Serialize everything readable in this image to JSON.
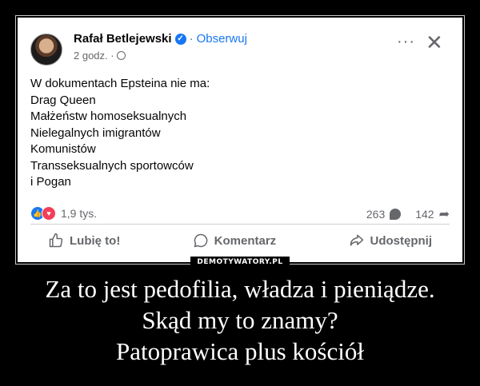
{
  "post": {
    "author": "Rafał Betlejewski",
    "separator": "·",
    "follow_label": "Obserwuj",
    "time": "2 godz. ·",
    "text_lines": [
      "W dokumentach Epsteina nie ma:",
      "Drag Queen",
      "Małżeństw homoseksualnych",
      "Nielegalnych imigrantów",
      "Komunistów",
      "Transseksualnych sportowców",
      "i Pogan"
    ],
    "reactions_count": "1,9 tys.",
    "comments_count": "263",
    "shares_count": "142",
    "more_label": "···",
    "close_label": "✕"
  },
  "actions": {
    "like": "Lubię to!",
    "comment": "Komentarz",
    "share": "Udostępnij"
  },
  "watermark": "DEMOTYWATORY.PL",
  "caption_lines": [
    "Za to jest pedofilia, władza i pieniądze.",
    "Skąd my to znamy?",
    "Patoprawica plus kościół"
  ],
  "colors": {
    "accent": "#1877f2",
    "love": "#f33e58",
    "muted_text": "#65676b",
    "background": "#000000"
  }
}
